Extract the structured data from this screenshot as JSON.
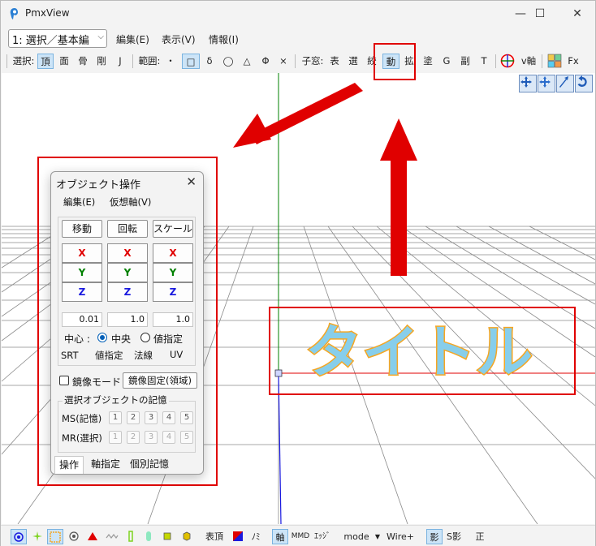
{
  "window": {
    "title": "PmxView",
    "controls": {
      "minimize": "—",
      "maximize": "☐",
      "close": "✕"
    }
  },
  "menubar": {
    "mode_select": "1: 選択／基本編",
    "items": [
      "編集(E)",
      "表示(V)",
      "情報(I)"
    ]
  },
  "toolbar": {
    "select_label": "選択:",
    "select_items": [
      "頂",
      "面",
      "骨",
      "剛",
      "J"
    ],
    "range_label": "範囲:",
    "range_items": [
      "・",
      "□",
      "δ",
      "◯",
      "△",
      "Φ",
      "×"
    ],
    "child_label": "子窓:",
    "child_items": [
      "表",
      "選",
      "絞",
      "動",
      "拡",
      "塗",
      "G",
      "副",
      "T"
    ],
    "vaxis_label": "v軸",
    "fx_label": "Fx"
  },
  "viewport": {
    "title_text": "タイトル"
  },
  "dialog": {
    "title": "オブジェクト操作",
    "close": "✕",
    "menu": [
      "編集(E)",
      "仮想軸(V)"
    ],
    "op_buttons": [
      "移動",
      "回転",
      "スケール"
    ],
    "axes": [
      "X",
      "Y",
      "Z"
    ],
    "values": [
      "0.01",
      "1.0",
      "1.0"
    ],
    "center_label": "中心 :",
    "center_options": [
      "中央",
      "値指定"
    ],
    "center_selected": "中央",
    "subtabs": [
      "SRT",
      "値指定",
      "法線",
      "UV"
    ],
    "mirror_mode": "鏡像モード",
    "mirror_fixed": "鏡像固定(領域)",
    "memory_group": "選択オブジェクトの記憶",
    "ms_label": "MS(記憶)",
    "mr_label": "MR(選択)",
    "slots": [
      "1",
      "2",
      "3",
      "4",
      "5"
    ],
    "bottom_tabs": [
      "操作",
      "軸指定",
      "個別記憶"
    ]
  },
  "statusbar": {
    "vertex_face": "表頂",
    "mi": "ﾉﾐ",
    "axis": "軸",
    "mmd": "MMD",
    "edge": "ｴｯｼﾞ",
    "mode": "mode",
    "wire": "Wire+",
    "shadow": "影",
    "sshadow": "S影",
    "sei": "正"
  },
  "colors": {
    "accent": "#005fb8",
    "selected_bg": "#cce4f7",
    "annotation_red": "#e00000",
    "title_fill": "#87ceeb",
    "title_outline": "#f5a623",
    "axis_x": "#e00000",
    "axis_y": "#008000",
    "axis_z": "#1a1adf"
  }
}
